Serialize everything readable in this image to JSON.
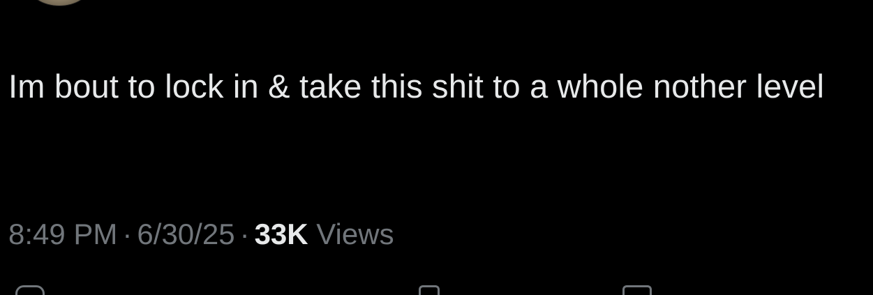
{
  "tweet": {
    "text": "Im bout to lock in & take this shit to a whole nother level",
    "time": "8:49 PM",
    "separator": "·",
    "date": "6/30/25",
    "views_count": "33K",
    "views_label": "Views"
  },
  "actions": {
    "icons": [
      "reply-icon",
      "repost-icon",
      "like-icon",
      "bookmark-icon"
    ]
  },
  "colors": {
    "background": "#000000",
    "text_primary": "#e7e9ea",
    "text_secondary": "#71767b"
  }
}
